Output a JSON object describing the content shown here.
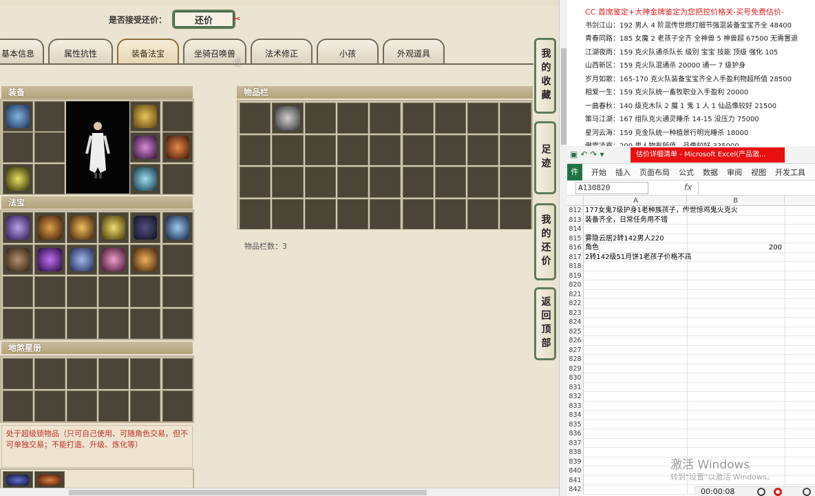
{
  "trade": {
    "accept_label": "是否接受还价：",
    "counter_button": "还价"
  },
  "tabs": [
    {
      "label": "基本信息"
    },
    {
      "label": "属性抗性"
    },
    {
      "label": "装备法宝",
      "active": true
    },
    {
      "label": "坐骑召唤兽"
    },
    {
      "label": "法术修正"
    },
    {
      "label": "小孩"
    },
    {
      "label": "外观道具"
    }
  ],
  "sections": {
    "equipment": "装备",
    "fabao": "法宝",
    "disha": "地煞星册",
    "inventory": "物品栏"
  },
  "inventory_count": "物品栏数：3",
  "warning_text": "处于超级锁物品（只可自己使用、可随角色交易，但不可单独交易；不能打造、升级、炼化等）",
  "side_buttons": [
    {
      "label": "我的收藏"
    },
    {
      "label": "足迹"
    },
    {
      "label": "我的还价"
    },
    {
      "label": "返回顶部"
    }
  ],
  "notes": {
    "header": "CC 首席鉴定+大神金牌鉴定为您把控价格关-买号免费估价-",
    "lines": [
      "书剑江山：192 男人 4 阶混传世燃灯细节强混装备宝宝齐全 48400",
      "青春同路：185 女魔 2 老孩子全齐 全神兽 5 神兽超 67500 无需置退",
      "江湖夜雨：159 克火队通杀队长 级别 宝宝 技能 顶级 强化 105",
      "山西新区：159 克火队混通杀 20000 通一 7 级护身",
      "岁月如歌：165-170 克火队装备宝宝齐全入手盈利物超所值 28500",
      "相爱一生：159 克火队统一畜牧职业入手盈利 20000",
      "一曲春秋：140 级克木队 2 魔 1 鬼 1 人 1 仙品像较好 21500",
      "策马江湖：167 组队克火通灵睡杀 14-15 没压力 75000",
      "星河云海：159 克金队统一种植景行明光睡杀 18000",
      "傲雪凌霜：200 男人物有所值，品像较好 335000"
    ]
  },
  "excel": {
    "doc_title": "估价详细清单 - Microsoft Excel(产品激...",
    "ribbon": [
      "件",
      "开始",
      "插入",
      "页面布局",
      "公式",
      "数据",
      "审阅",
      "视图",
      "开发工具"
    ],
    "namebox": "A130820",
    "fx": "fx",
    "columns": [
      "A",
      "B"
    ],
    "rows": [
      {
        "n": "812",
        "a": "177女鬼7级护身1老种族孩子，传世惊鸡鬼火克火",
        "b": ""
      },
      {
        "n": "813",
        "a": "装备齐全，日常任务用不错",
        "b": ""
      },
      {
        "n": "814",
        "a": "",
        "b": ""
      },
      {
        "n": "815",
        "a": "雾隐云居2转142男人220",
        "b": ""
      },
      {
        "n": "816",
        "a": "角色",
        "b": "200"
      },
      {
        "n": "817",
        "a": "2转142级51月饼1老孩子价格不高",
        "b": ""
      },
      {
        "n": "818",
        "a": "",
        "b": ""
      },
      {
        "n": "819",
        "a": "",
        "b": ""
      },
      {
        "n": "820",
        "a": "",
        "b": ""
      },
      {
        "n": "821",
        "a": "",
        "b": ""
      },
      {
        "n": "822",
        "a": "",
        "b": ""
      },
      {
        "n": "823",
        "a": "",
        "b": ""
      },
      {
        "n": "824",
        "a": "",
        "b": ""
      },
      {
        "n": "825",
        "a": "",
        "b": ""
      },
      {
        "n": "826",
        "a": "",
        "b": ""
      },
      {
        "n": "827",
        "a": "",
        "b": ""
      },
      {
        "n": "828",
        "a": "",
        "b": ""
      },
      {
        "n": "829",
        "a": "",
        "b": ""
      },
      {
        "n": "830",
        "a": "",
        "b": ""
      },
      {
        "n": "831",
        "a": "",
        "b": ""
      },
      {
        "n": "832",
        "a": "",
        "b": ""
      },
      {
        "n": "833",
        "a": "",
        "b": ""
      },
      {
        "n": "834",
        "a": "",
        "b": ""
      },
      {
        "n": "835",
        "a": "",
        "b": ""
      },
      {
        "n": "836",
        "a": "",
        "b": ""
      },
      {
        "n": "837",
        "a": "",
        "b": ""
      },
      {
        "n": "838",
        "a": "",
        "b": ""
      },
      {
        "n": "839",
        "a": "",
        "b": ""
      },
      {
        "n": "840",
        "a": "",
        "b": ""
      },
      {
        "n": "841",
        "a": "",
        "b": ""
      },
      {
        "n": "842",
        "a": "",
        "b": ""
      }
    ]
  },
  "watermark": {
    "title": "激活 Windows",
    "sub": "转到\"设置\"以激活 Windows。"
  },
  "recorder": {
    "time": "00:00:08"
  },
  "colors": {
    "accent_green": "#5f7b5a",
    "warning_red": "#c0302a",
    "excel_green": "#217346",
    "excel_title_red": "#e81010"
  }
}
